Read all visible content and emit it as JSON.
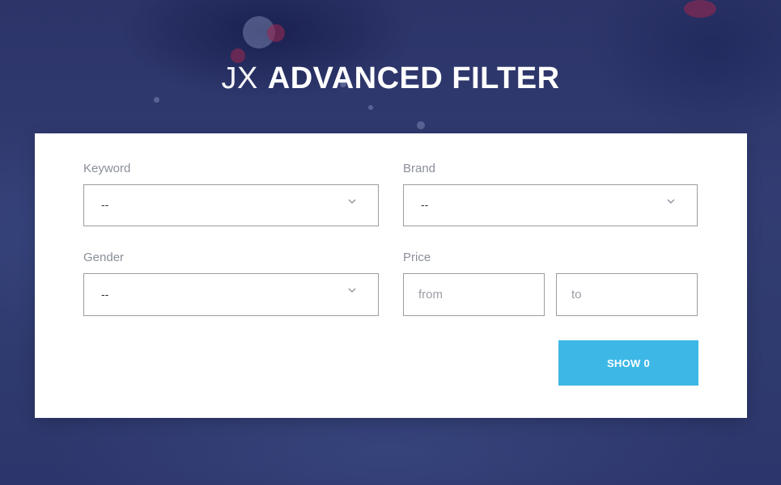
{
  "header": {
    "title_light": "JX",
    "title_bold": "ADVANCED FILTER"
  },
  "filter": {
    "keyword": {
      "label": "Keyword",
      "value": "--"
    },
    "brand": {
      "label": "Brand",
      "value": "--"
    },
    "gender": {
      "label": "Gender",
      "value": "--"
    },
    "price": {
      "label": "Price",
      "from_placeholder": "from",
      "to_placeholder": "to"
    },
    "submit_label": "SHOW 0"
  },
  "icons": {
    "dropdown": "chevron-down-icon"
  },
  "colors": {
    "background": "#2f3a6e",
    "panel": "#ffffff",
    "button": "#3db8e6",
    "label_text": "#8a8f99",
    "border": "#9a9da3"
  }
}
